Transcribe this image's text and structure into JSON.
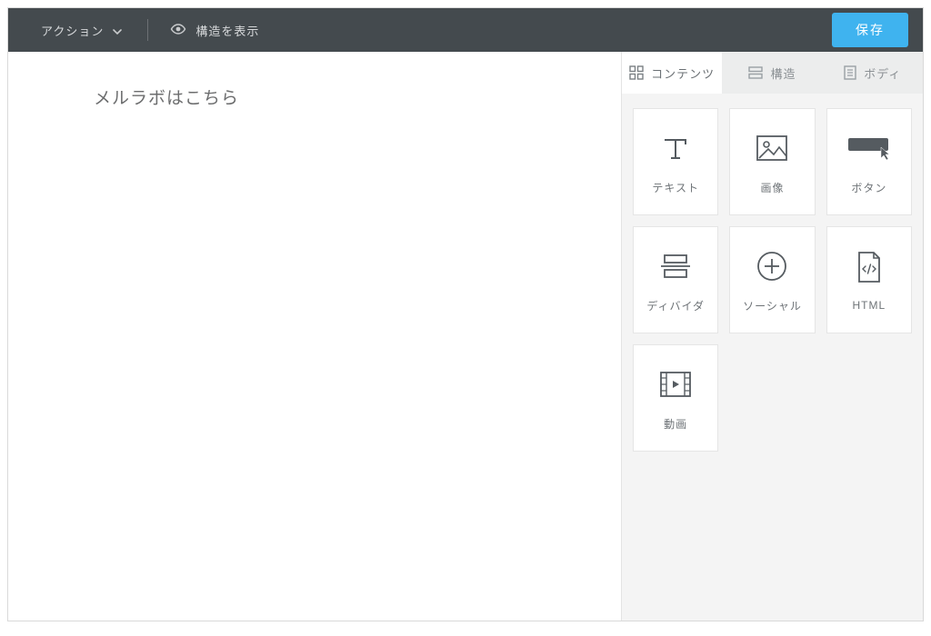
{
  "toolbar": {
    "action_label": "アクション",
    "show_structure_label": "構造を表示",
    "save_label": "保存"
  },
  "canvas": {
    "text": "メルラボはこちら"
  },
  "sidepanel": {
    "tabs": {
      "contents": "コンテンツ",
      "structure": "構造",
      "body": "ボディ"
    },
    "tiles": {
      "text": "テキスト",
      "image": "画像",
      "button": "ボタン",
      "divider": "ディバイダ",
      "social": "ソーシャル",
      "html": "HTML",
      "video": "動画"
    }
  }
}
